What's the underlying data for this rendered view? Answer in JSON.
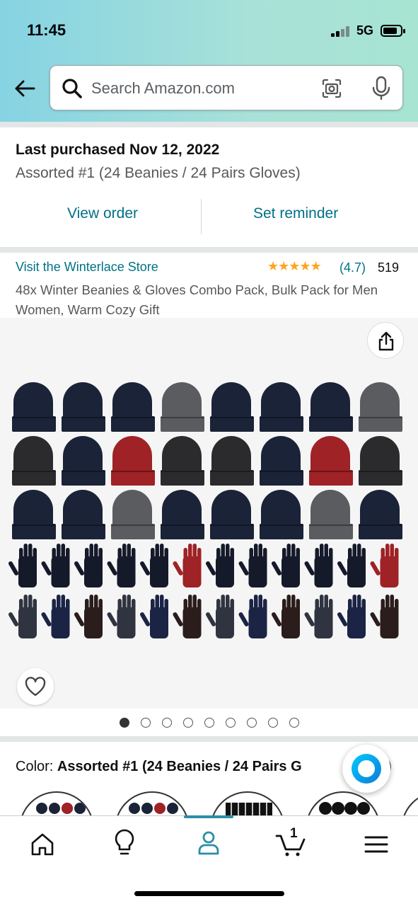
{
  "status_bar": {
    "time": "11:45",
    "network": "5G"
  },
  "search": {
    "placeholder": "Search Amazon.com"
  },
  "purchase": {
    "title": "Last purchased Nov 12, 2022",
    "subtitle": "Assorted #1 (24 Beanies / 24 Pairs Gloves)",
    "view_order": "View order",
    "set_reminder": "Set reminder"
  },
  "product": {
    "store": "Visit the Winterlace Store",
    "stars_glyph": "★★★★★",
    "rating": "(4.7)",
    "review_count": "519",
    "title": "48x Winter Beanies & Gloves Combo Pack, Bulk Pack for Men Women, Warm Cozy Gift"
  },
  "image_pager": {
    "total": 9,
    "active": 1
  },
  "color": {
    "label": "Color: ",
    "value": "Assorted #1 (24 Beanies / 24 Pairs G",
    "value_tail": ")"
  },
  "tabbar": {
    "cart_count": "1"
  },
  "colors": {
    "link": "#007185",
    "star": "#ffa41c",
    "navy": "#1b2338",
    "charcoal": "#2b2b2e",
    "grey": "#5a5c60",
    "red": "#9e2226",
    "tab_active": "#2a8fa6"
  }
}
